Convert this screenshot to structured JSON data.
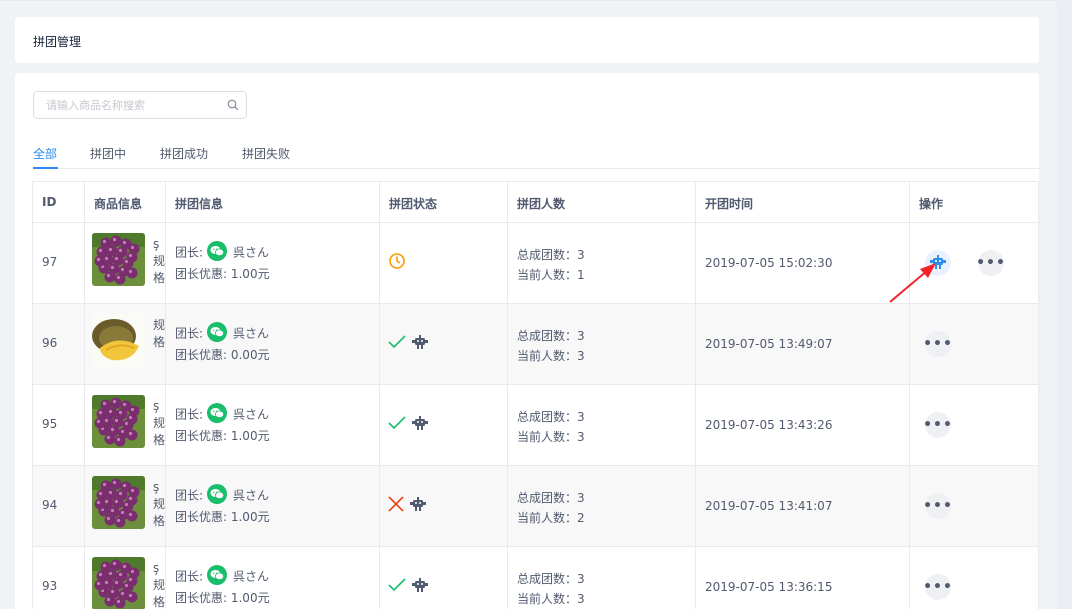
{
  "header": {
    "title": "拼团管理"
  },
  "search": {
    "placeholder": "请输入商品名称搜索"
  },
  "tabs": [
    {
      "label": "全部",
      "active": true
    },
    {
      "label": "拼团中",
      "active": false
    },
    {
      "label": "拼团成功",
      "active": false
    },
    {
      "label": "拼团失败",
      "active": false
    }
  ],
  "columns": {
    "id": "ID",
    "product": "商品信息",
    "group_info": "拼团信息",
    "status": "拼团状态",
    "members": "拼团人数",
    "start_time": "开团时间",
    "actions": "操作"
  },
  "labels": {
    "leader": "团长:",
    "discount_prefix": "团长优惠:",
    "total_prefix": "总成团数:",
    "current_prefix": "当前人数:"
  },
  "rows": [
    {
      "id": "97",
      "image": "grapes",
      "spec_text": "ş规格",
      "leader_name": "呉さん",
      "discount": "团长优惠: 1.00元",
      "status": "in-progress",
      "total": "总成团数：3",
      "current": "当前人数：1",
      "time": "2019-07-05 15:02:30",
      "actions": [
        "view-group",
        "more"
      ]
    },
    {
      "id": "96",
      "image": "durian",
      "spec_text": "规格",
      "leader_name": "呉さん",
      "discount": "团长优惠: 0.00元",
      "status": "success",
      "total": "总成团数：3",
      "current": "当前人数：3",
      "time": "2019-07-05 13:49:07",
      "actions": [
        "more"
      ]
    },
    {
      "id": "95",
      "image": "grapes",
      "spec_text": "ş规格",
      "leader_name": "呉さん",
      "discount": "团长优惠: 1.00元",
      "status": "success",
      "total": "总成团数：3",
      "current": "当前人数：3",
      "time": "2019-07-05 13:43:26",
      "actions": [
        "more"
      ]
    },
    {
      "id": "94",
      "image": "grapes",
      "spec_text": "ş规格",
      "leader_name": "呉さん",
      "discount": "团长优惠: 1.00元",
      "status": "failed",
      "total": "总成团数：3",
      "current": "当前人数：2",
      "time": "2019-07-05 13:41:07",
      "actions": [
        "more"
      ]
    },
    {
      "id": "93",
      "image": "grapes",
      "spec_text": "ş规格",
      "leader_name": "呉さん",
      "discount": "团长优惠: 1.00元",
      "status": "success",
      "total": "总成团数：3",
      "current": "当前人数：3",
      "time": "2019-07-05 13:36:15",
      "actions": [
        "more"
      ]
    }
  ],
  "colors": {
    "accent": "#2d8cf0",
    "success": "#19be6b",
    "error": "#ed4014",
    "warning": "#ff9900",
    "annotation_arrow": "#f5222d"
  },
  "icons": {
    "search": "search-icon",
    "wechat": "wechat-icon",
    "clock": "clock-icon",
    "check": "check-icon",
    "cross": "cross-icon",
    "robot": "robot-icon",
    "more": "more-icon"
  }
}
